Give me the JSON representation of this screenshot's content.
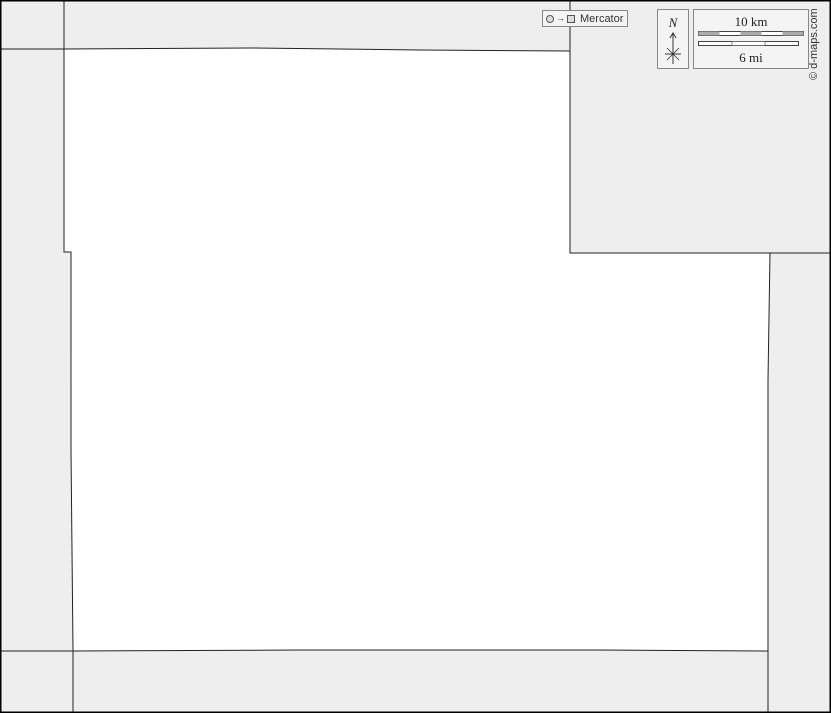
{
  "map": {
    "colors": {
      "background_region": "#eeeeee",
      "focus_region": "#ffffff",
      "border_line": "#222222",
      "frame": "#000000"
    }
  },
  "legend": {
    "projection_label": "Mercator",
    "north_label": "N",
    "scale_km_label": "10 km",
    "scale_mi_label": "6 mi"
  },
  "credit": "© d-maps.com"
}
